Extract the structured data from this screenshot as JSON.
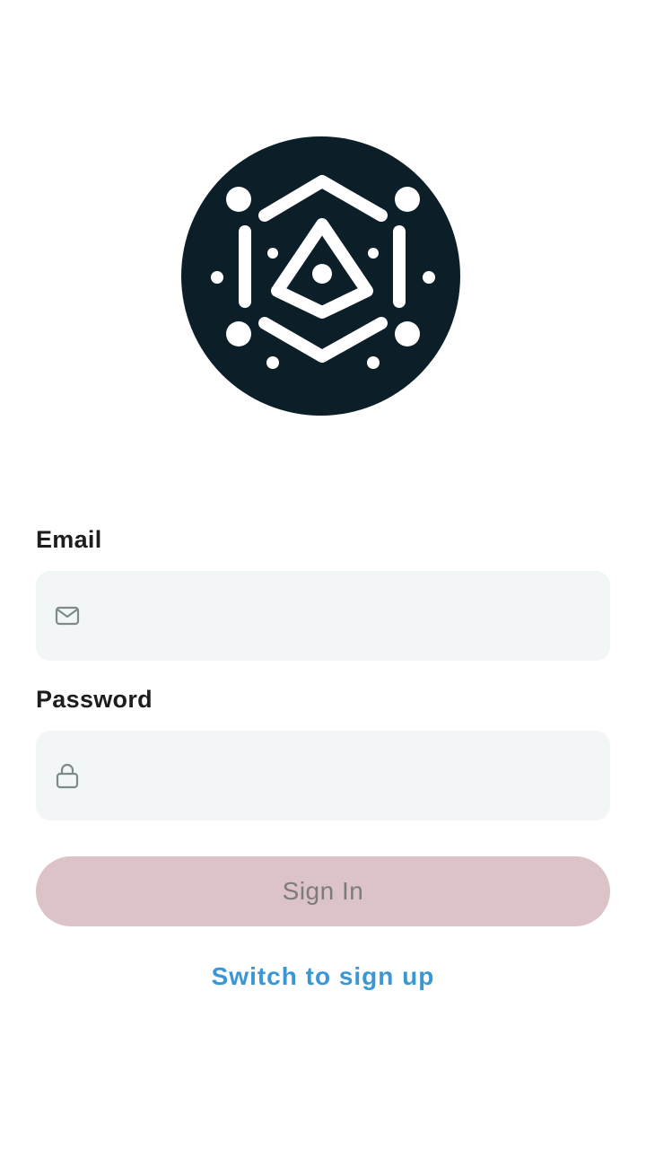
{
  "logo": {
    "icon": "hexagon-eye-logo",
    "background_color": "#0c1f28",
    "foreground_color": "#ffffff"
  },
  "email": {
    "label": "Email",
    "value": "",
    "icon": "mail-icon"
  },
  "password": {
    "label": "Password",
    "value": "",
    "icon": "lock-icon"
  },
  "sign_in": {
    "label": "Sign In",
    "color": "#dcc3c7"
  },
  "switch": {
    "label": "Switch to sign up",
    "color": "#3b97d3"
  }
}
